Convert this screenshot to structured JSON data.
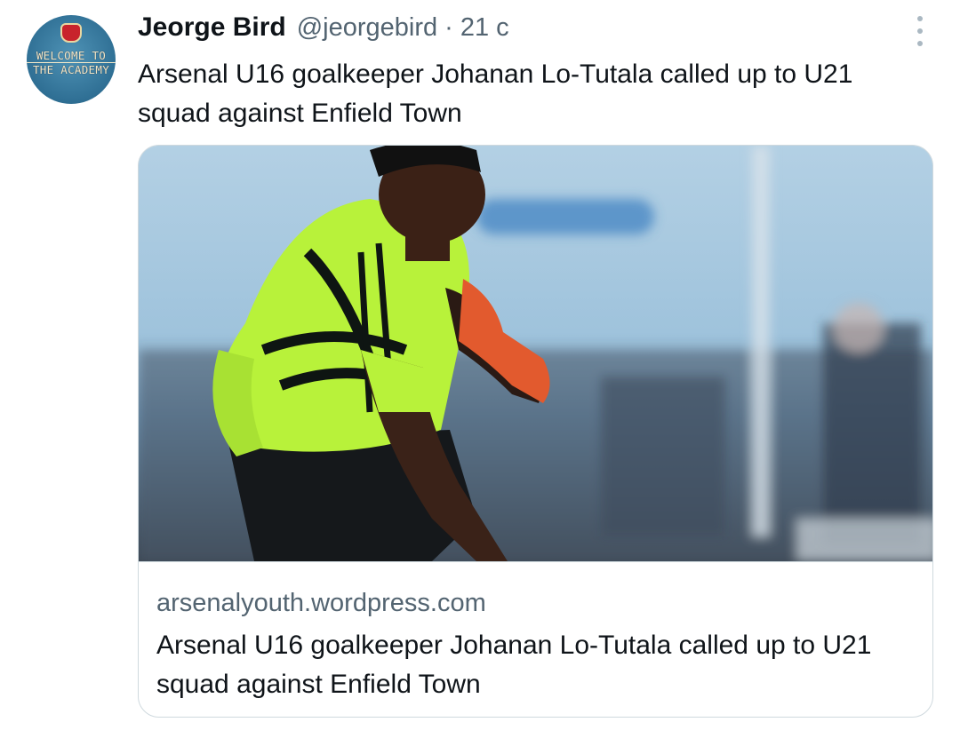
{
  "author": {
    "display_name": "Jeorge Bird",
    "handle": "@jeorgebird",
    "separator": "·",
    "time": "21 с",
    "avatar_text_line1": "WELCOME TO",
    "avatar_text_line2": "THE ACADEMY"
  },
  "tweet": {
    "text": "Arsenal U16 goalkeeper Johanan Lo-Tutala called up to U21 squad against Enfield Town"
  },
  "card": {
    "domain": "arsenalyouth.wordpress.com",
    "title": "Arsenal U16 goalkeeper Johanan Lo-Tutala called up to U21 squad against Enfield Town"
  },
  "icons": {
    "more": "more-vertical-icon"
  },
  "colors": {
    "text_primary": "#0f1419",
    "text_secondary": "#536471",
    "border": "#cfd9de",
    "jersey": "#b8f23a"
  }
}
